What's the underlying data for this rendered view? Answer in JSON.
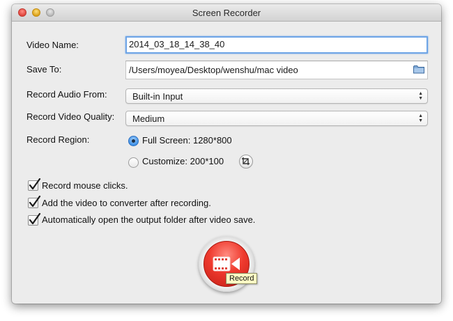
{
  "window": {
    "title": "Screen Recorder"
  },
  "form": {
    "video_name_label": "Video Name:",
    "video_name_value": "2014_03_18_14_38_40",
    "save_to_label": "Save To:",
    "save_to_value": "/Users/moyea/Desktop/wenshu/mac video",
    "audio_label": "Record Audio From:",
    "audio_value": "Built-in Input",
    "quality_label": "Record Video Quality:",
    "quality_value": "Medium",
    "region_label": "Record Region:",
    "region_full_label": "Full Screen: 1280*800",
    "region_custom_label": "Customize: 200*100",
    "region_selected": "full_screen"
  },
  "checkboxes": [
    {
      "label": "Record mouse clicks.",
      "checked": true
    },
    {
      "label": "Add the video to converter after recording.",
      "checked": true
    },
    {
      "label": "Automatically open the output folder after video save.",
      "checked": true
    }
  ],
  "record": {
    "tooltip": "Record"
  },
  "colors": {
    "record_red": "#ef3a2e",
    "focus_ring": "#6ea5e6",
    "radio_blue": "#3a8ee6"
  },
  "icons": {
    "folder": "folder-icon",
    "crop": "crop-icon",
    "record": "video-camera-icon",
    "checkmark": "checkmark-icon"
  }
}
